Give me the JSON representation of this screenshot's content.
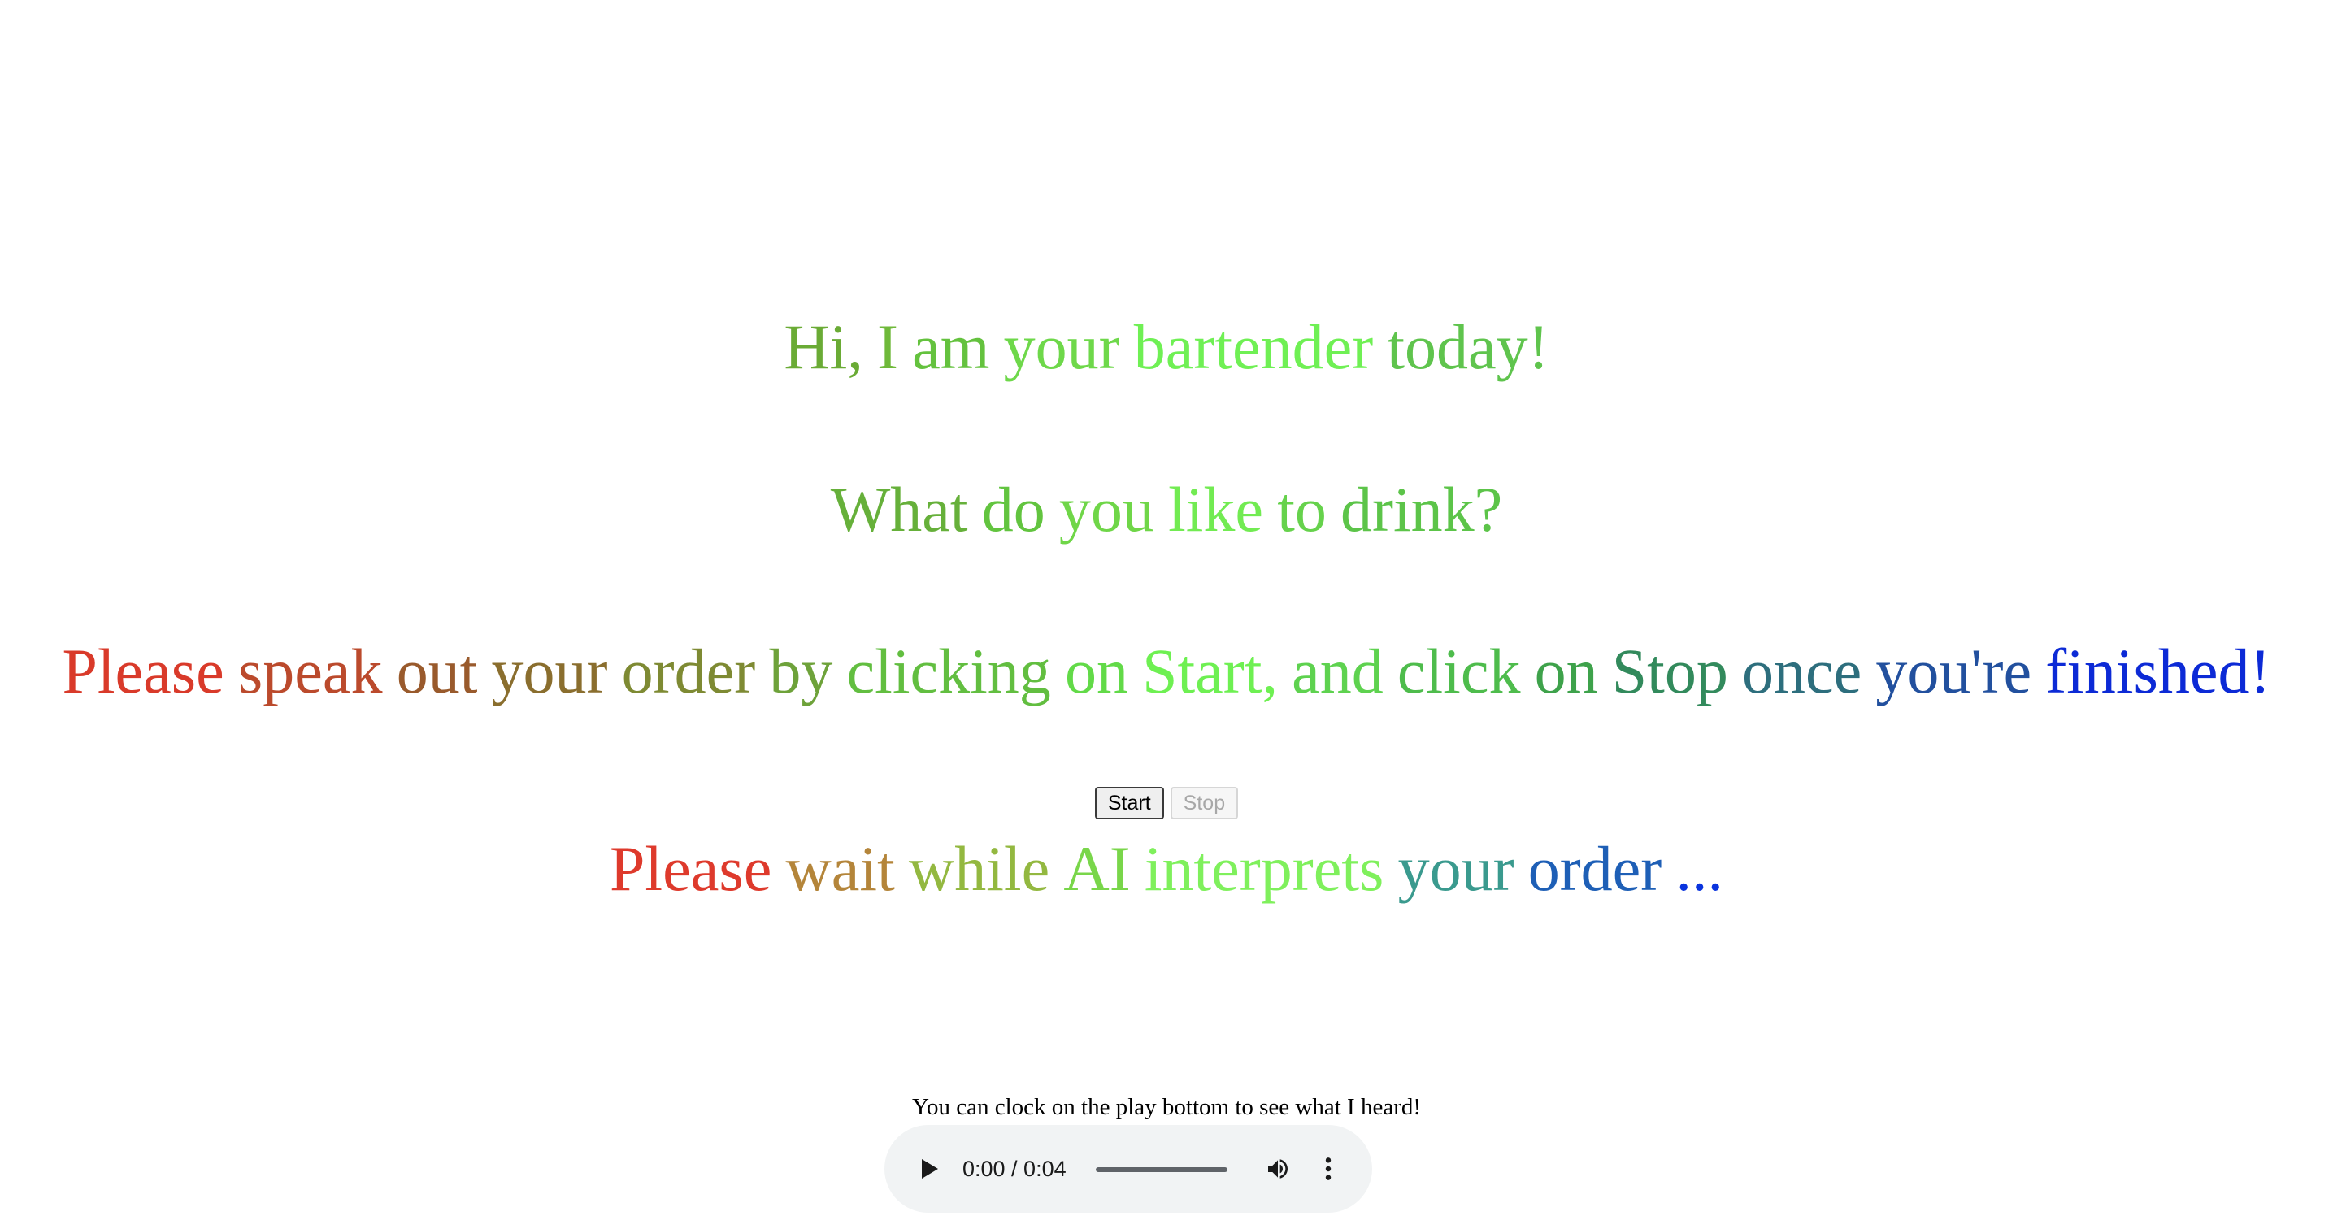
{
  "greeting": {
    "words": [
      {
        "text": "Hi,",
        "color": "#6aab35"
      },
      {
        "text": "I",
        "color": "#6fb93a"
      },
      {
        "text": "am",
        "color": "#64c23e"
      },
      {
        "text": "your",
        "color": "#6ed84a"
      },
      {
        "text": "bartender",
        "color": "#6ff054"
      },
      {
        "text": "today!",
        "color": "#5fc44d"
      }
    ]
  },
  "question": {
    "words": [
      {
        "text": "What",
        "color": "#66b03a"
      },
      {
        "text": "do",
        "color": "#62c43f"
      },
      {
        "text": "you",
        "color": "#6fd648"
      },
      {
        "text": "like",
        "color": "#72eb52"
      },
      {
        "text": "to",
        "color": "#66d24c"
      },
      {
        "text": "drink?",
        "color": "#5cc449"
      }
    ]
  },
  "instruction": {
    "words": [
      {
        "text": "Please",
        "color": "#d93a2a"
      },
      {
        "text": "speak",
        "color": "#bb4a2c"
      },
      {
        "text": "out",
        "color": "#995a2c"
      },
      {
        "text": "your",
        "color": "#8a6e2e"
      },
      {
        "text": "order",
        "color": "#7e8a33"
      },
      {
        "text": "by",
        "color": "#6ea23a"
      },
      {
        "text": "clicking",
        "color": "#62be40"
      },
      {
        "text": "on",
        "color": "#62da48"
      },
      {
        "text": "Start,",
        "color": "#6ef052"
      },
      {
        "text": "and",
        "color": "#5ed24f"
      },
      {
        "text": "click",
        "color": "#4ebc4c"
      },
      {
        "text": "on",
        "color": "#3ea24b"
      },
      {
        "text": "Stop",
        "color": "#328a5c"
      },
      {
        "text": "once",
        "color": "#2d6e7d"
      },
      {
        "text": "you're",
        "color": "#22509e"
      },
      {
        "text": "finished!",
        "color": "#0c2ad6"
      }
    ]
  },
  "controls": {
    "start_label": "Start",
    "stop_label": "Stop"
  },
  "wait_message": {
    "words": [
      {
        "text": "Please",
        "color": "#de3a2c"
      },
      {
        "text": "wait",
        "color": "#b4853a"
      },
      {
        "text": "while",
        "color": "#93b840"
      },
      {
        "text": "AI",
        "color": "#79d64a"
      },
      {
        "text": "interprets",
        "color": "#7ff05c"
      },
      {
        "text": "your",
        "color": "#3a9a8e"
      },
      {
        "text": "order",
        "color": "#1e5fb6"
      },
      {
        "text": "...",
        "color": "#0a34de"
      }
    ]
  },
  "hint": {
    "text": "You can clock on the play bottom to see what I heard!"
  },
  "audio_player": {
    "time_display": "0:00 / 0:04",
    "progress": 0,
    "icons": {
      "play": "play-icon",
      "volume": "volume-icon",
      "more": "more-options-icon"
    }
  }
}
